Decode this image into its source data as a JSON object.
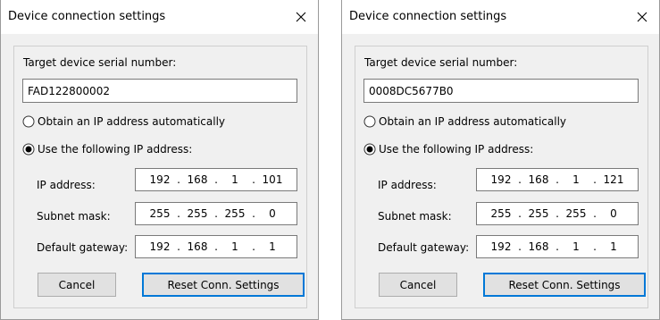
{
  "dialogs": [
    {
      "title": "Device connection settings",
      "serial_label": "Target device serial number:",
      "serial_value": "FAD122800002",
      "radio_auto_label": "Obtain an IP address automatically",
      "radio_manual_label": "Use the following IP address:",
      "selected": "manual",
      "ip_label": "IP address:",
      "ip": [
        "192",
        "168",
        "1",
        "101"
      ],
      "mask_label": "Subnet mask:",
      "mask": [
        "255",
        "255",
        "255",
        "0"
      ],
      "gateway_label": "Default gateway:",
      "gateway": [
        "192",
        "168",
        "1",
        "1"
      ],
      "cancel_label": "Cancel",
      "reset_label": "Reset Conn. Settings"
    },
    {
      "title": "Device connection settings",
      "serial_label": "Target device serial number:",
      "serial_value": "0008DC5677B0",
      "radio_auto_label": "Obtain an IP address automatically",
      "radio_manual_label": "Use the following IP address:",
      "selected": "manual",
      "ip_label": "IP address:",
      "ip": [
        "192",
        "168",
        "1",
        "121"
      ],
      "mask_label": "Subnet mask:",
      "mask": [
        "255",
        "255",
        "255",
        "0"
      ],
      "gateway_label": "Default gateway:",
      "gateway": [
        "192",
        "168",
        "1",
        "1"
      ],
      "cancel_label": "Cancel",
      "reset_label": "Reset Conn. Settings"
    }
  ],
  "colors": {
    "default_button_border": "#0078d7",
    "dialog_background": "#f0f0f0",
    "titlebar_background": "#ffffff"
  },
  "icons": {
    "close": "close-icon",
    "radio_checked": "radio-checked-icon",
    "radio_unchecked": "radio-unchecked-icon"
  }
}
